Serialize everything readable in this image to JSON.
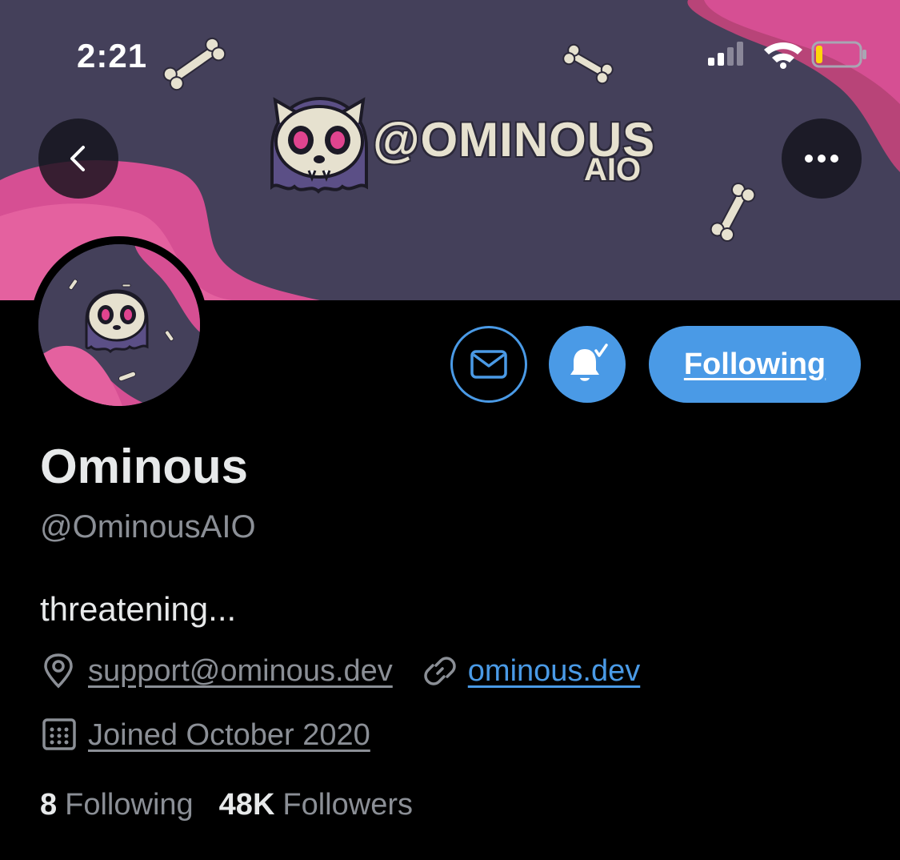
{
  "status_bar": {
    "time": "2:21"
  },
  "banner": {
    "brand_text": "@OMINOUS",
    "brand_sub": "AIO"
  },
  "profile": {
    "name": "Ominous",
    "handle": "@OminousAIO",
    "bio": "threatening...",
    "location": "support@ominous.dev",
    "website": "ominous.dev",
    "joined": "Joined October 2020"
  },
  "actions": {
    "following_label": "Following"
  },
  "stats": {
    "following_count": "8",
    "following_label": "Following",
    "followers_count": "48K",
    "followers_label": "Followers"
  },
  "colors": {
    "accent": "#4a9ae6",
    "banner_bg": "#44405a",
    "pink": "#d64f93"
  }
}
